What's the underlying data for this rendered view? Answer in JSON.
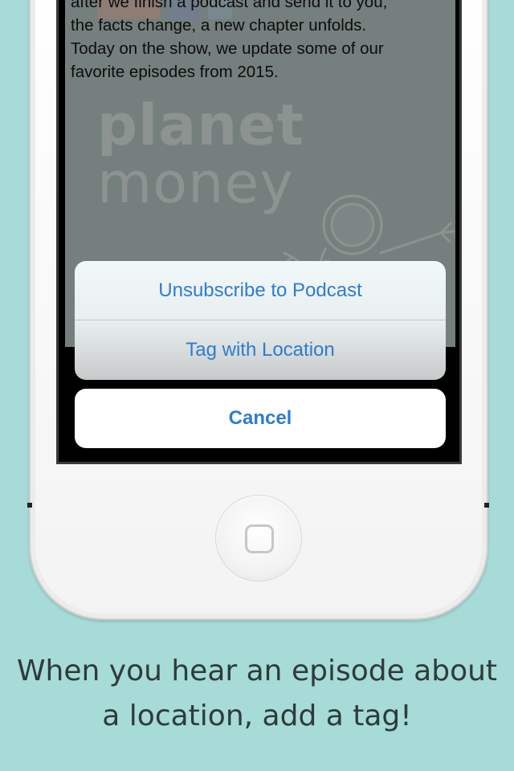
{
  "screen": {
    "description": [
      "after we finish a podcast and send it to you,",
      "the facts change, a new chapter unfolds.",
      "Today on the show, we update some of our",
      "favorite episodes from 2015."
    ],
    "brand": {
      "line1": "planet",
      "line2": "money"
    }
  },
  "action_sheet": {
    "option1": "Unsubscribe to Podcast",
    "option2": "Tag with Location",
    "cancel": "Cancel"
  },
  "caption": {
    "line1": "When you hear an episode about",
    "line2": "a location, add a tag!"
  },
  "colors": {
    "background": "#a6dbd7",
    "action_text": "#2f7bd0"
  }
}
